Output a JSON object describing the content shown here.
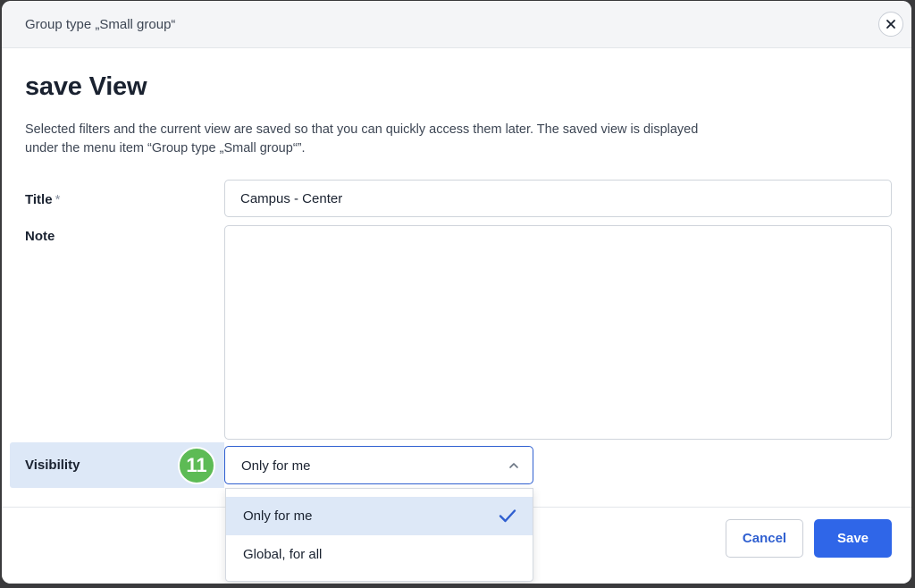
{
  "header": {
    "title": "Group type „Small group“"
  },
  "dialog": {
    "title": "save View",
    "description": "Selected filters and the current view are saved so that you can quickly access them later. The saved view is displayed under the menu item “Group type „Small group“”."
  },
  "form": {
    "title_label": "Title",
    "title_required_mark": "*",
    "title_value": "Campus - Center",
    "note_label": "Note",
    "note_value": "",
    "visibility_label": "Visibility",
    "visibility_selected": "Only for me",
    "visibility_options": [
      {
        "label": "Only for me",
        "selected": true
      },
      {
        "label": "Global, for all",
        "selected": false
      }
    ]
  },
  "annotation": {
    "step_number": "11",
    "color": "#5dbb55"
  },
  "footer": {
    "cancel_label": "Cancel",
    "save_label": "Save"
  },
  "colors": {
    "accent": "#2f66e8",
    "highlight": "#dde8f7",
    "check": "#2f5fd0"
  },
  "icons": {
    "close": "close-icon",
    "chevron": "chevron-up-icon",
    "check": "check-icon"
  }
}
